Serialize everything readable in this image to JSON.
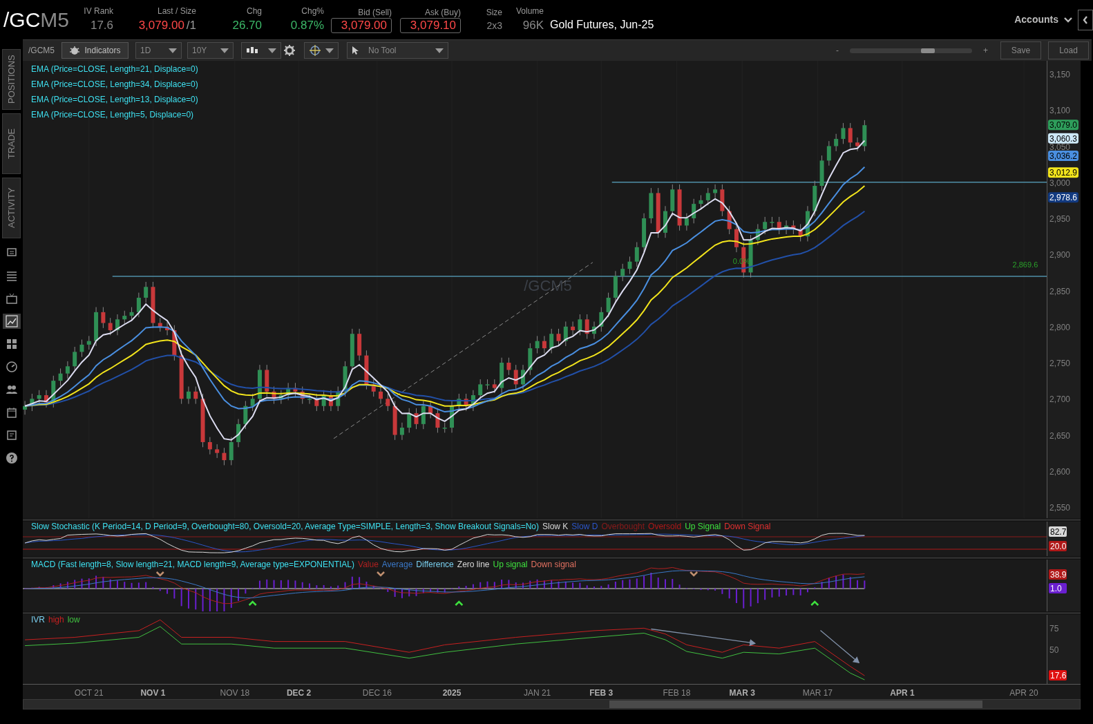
{
  "quote_bar": {
    "symbol_root": "/GC",
    "symbol_month": "M5",
    "fields": [
      {
        "label": "IV Rank",
        "value": "17.6",
        "kind": "plain"
      },
      {
        "label": "Last / Size",
        "value": "3,079.00",
        "suffix": "/1",
        "kind": "last"
      },
      {
        "label": "Chg",
        "value": "26.70",
        "kind": "up"
      },
      {
        "label": "Chg%",
        "value": "0.87%",
        "kind": "up"
      },
      {
        "label": "Bid (Sell)",
        "value": "3,079.00",
        "kind": "boxed"
      },
      {
        "label": "Ask (Buy)",
        "value": "3,079.10",
        "kind": "boxed"
      },
      {
        "label": "Size",
        "value": "2x3",
        "kind": "small"
      },
      {
        "label": "Volume",
        "value": "96K",
        "kind": "plain"
      }
    ],
    "description": "Gold Futures, Jun-25",
    "accounts": "Accounts"
  },
  "side_tabs": [
    {
      "label": "POSITIONS",
      "selected": false
    },
    {
      "label": "TRADE",
      "selected": false
    },
    {
      "label": "ACTIVITY",
      "selected": false
    }
  ],
  "side_icons": [
    {
      "kind": "monitor",
      "selected": false
    },
    {
      "kind": "list",
      "selected": false
    },
    {
      "kind": "tv",
      "selected": false
    },
    {
      "kind": "chart",
      "selected": true
    },
    {
      "kind": "grid",
      "selected": false
    },
    {
      "kind": "gauge",
      "selected": false
    },
    {
      "kind": "people",
      "selected": false
    },
    {
      "kind": "calendar",
      "selected": false
    },
    {
      "kind": "news",
      "selected": false
    },
    {
      "kind": "help",
      "selected": false
    }
  ],
  "toolbar": {
    "symbol": "/GCM5",
    "indicators": "Indicators",
    "aggregation": "1D",
    "period": "10Y",
    "tool": "No Tool",
    "zoom_minus": "-",
    "zoom_plus": "+",
    "zoom": {
      "level": 0.64
    },
    "save": "Save",
    "load": "Load"
  },
  "price_chart": {
    "studies": [
      {
        "label": "EMA (Price=CLOSE, Length=21, Displace=0)"
      },
      {
        "label": "EMA (Price=CLOSE, Length=34, Displace=0)"
      },
      {
        "label": "EMA (Price=CLOSE, Length=13, Displace=0)"
      },
      {
        "label": "EMA (Price=CLOSE, Length=5, Displace=0)"
      }
    ],
    "watermark": "/GCM5",
    "price_axis": [
      "3,150",
      "3,100",
      "3,050",
      "3,000",
      "2,950",
      "2,900",
      "2,850",
      "2,800",
      "2,750",
      "2,700",
      "2,650",
      "2,600",
      "2,550"
    ],
    "level_labels": [
      "0.0%",
      "2,869.6"
    ],
    "price_tags": [
      {
        "text": "3,079.0",
        "color": "#2e9e5b"
      },
      {
        "text": "3,060.3",
        "color": "#cde8f8"
      },
      {
        "text": "3,036.2",
        "color": "#4a8fe0"
      },
      {
        "text": "3,012.9",
        "color": "#f2e41c"
      },
      {
        "text": "2,978.6",
        "color": "#123a80"
      }
    ]
  },
  "stochastic": {
    "title": "Slow Stochastic (K Period=14, D Period=9, Overbought=80, Oversold=20, Average Type=SIMPLE, Length=3, Show Breakout Signals=No)",
    "legend": [
      {
        "label": "Slow K",
        "color": "#d8d8d8"
      },
      {
        "label": "Slow D",
        "color": "#2b55c8"
      },
      {
        "label": "Overbought",
        "color": "#8a1a1a"
      },
      {
        "label": "Oversold",
        "color": "#b01818"
      },
      {
        "label": "Up Signal",
        "color": "#3ee03e"
      },
      {
        "label": "Down Signal",
        "color": "#e03030"
      }
    ],
    "readouts": [
      {
        "text": "82.7",
        "color": "#d8d8d8"
      },
      {
        "text": "20.0",
        "color": "#b01818"
      }
    ]
  },
  "macd": {
    "title": "MACD (Fast length=8, Slow length=21, MACD length=9, Average type=EXPONENTIAL)",
    "legend": [
      {
        "label": "Value",
        "color": "#b02020"
      },
      {
        "label": "Average",
        "color": "#3a78c8"
      },
      {
        "label": "Difference",
        "color": "#7ad0f0"
      },
      {
        "label": "Zero line",
        "color": "#d8d8d8"
      },
      {
        "label": "Up signal",
        "color": "#3ee03e"
      },
      {
        "label": "Down signal",
        "color": "#e07060"
      }
    ],
    "readouts": [
      {
        "text": "38.9",
        "color": "#b01818"
      },
      {
        "text": "1.0",
        "color": "#6a1fd0"
      }
    ]
  },
  "ivr": {
    "title": "IVR",
    "legend": [
      {
        "label": "high",
        "color": "#c82020"
      },
      {
        "label": "low",
        "color": "#40c040"
      }
    ],
    "axis_labels": [
      "75",
      "50"
    ],
    "readout": {
      "text": "17.6",
      "color": "#e01010"
    }
  },
  "date_axis": [
    {
      "label": "OCT 21",
      "bold": false
    },
    {
      "label": "NOV 1",
      "bold": true
    },
    {
      "label": "NOV 18",
      "bold": false
    },
    {
      "label": "DEC 2",
      "bold": true
    },
    {
      "label": "DEC 16",
      "bold": false
    },
    {
      "label": "2025",
      "bold": true
    },
    {
      "label": "JAN 21",
      "bold": false
    },
    {
      "label": "FEB 3",
      "bold": true
    },
    {
      "label": "FEB 18",
      "bold": false
    },
    {
      "label": "MAR 3",
      "bold": true
    },
    {
      "label": "MAR 17",
      "bold": false
    },
    {
      "label": "APR 1",
      "bold": true
    },
    {
      "label": "APR 20",
      "bold": false
    }
  ]
}
